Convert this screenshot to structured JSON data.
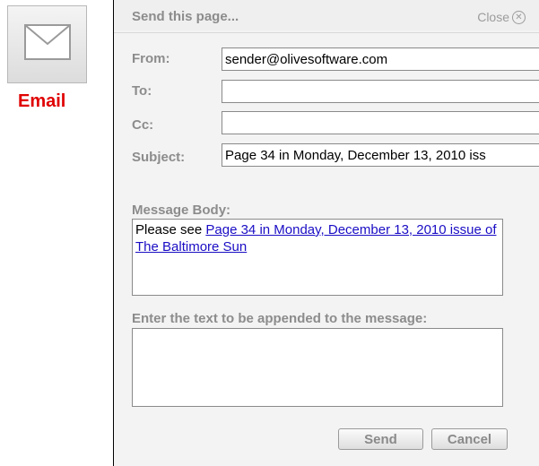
{
  "email_tile": {
    "label": "Email"
  },
  "dialog": {
    "title": "Send this page...",
    "close_label": "Close",
    "fields": {
      "from_label": "From:",
      "from_value": "sender@olivesoftware.com",
      "to_label": "To:",
      "to_value": "",
      "cc_label": "Cc:",
      "cc_value": "",
      "subject_label": "Subject:",
      "subject_value": "Page 34 in Monday, December 13, 2010 iss"
    },
    "message_body": {
      "label": "Message Body:",
      "prefix": "Please see ",
      "link_text": "Page 34 in Monday, December 13, 2010 issue of The Baltimore Sun"
    },
    "append": {
      "label": "Enter the text to be appended to the message:",
      "value": ""
    },
    "buttons": {
      "send": "Send",
      "cancel": "Cancel"
    }
  }
}
